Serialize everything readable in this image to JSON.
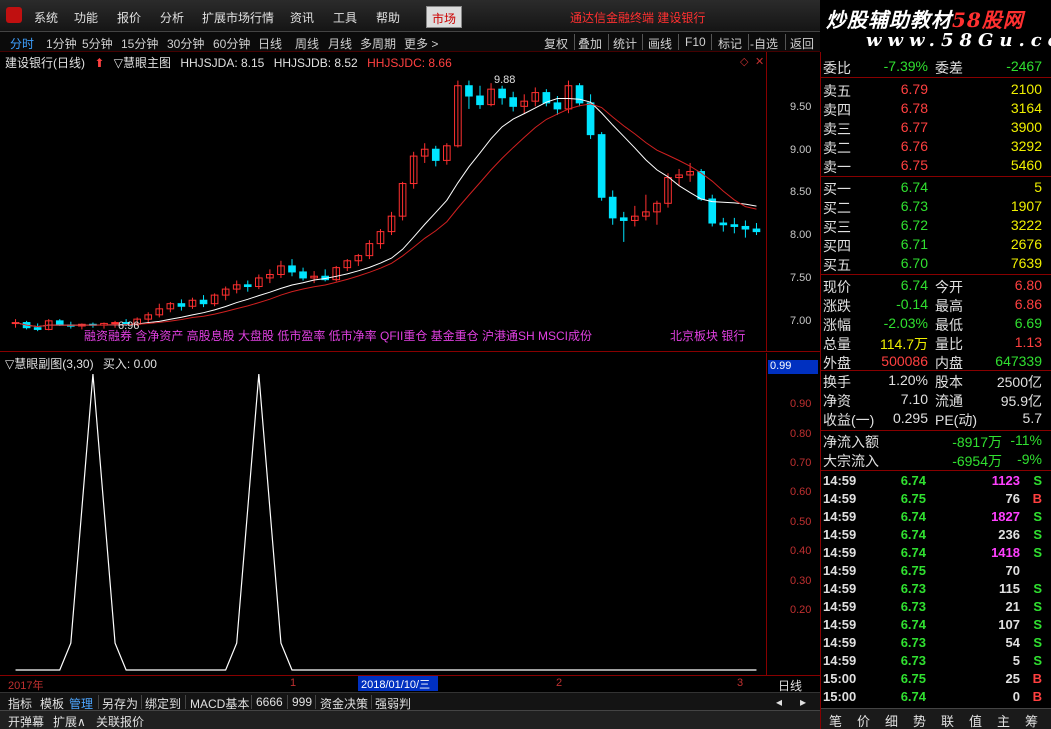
{
  "menu": {
    "items": [
      "系统",
      "功能",
      "报价",
      "分析",
      "扩展市场行情",
      "资讯",
      "工具",
      "帮助"
    ],
    "market_tab": "市场",
    "right_text": "通达信金融终端  建设银行"
  },
  "logo": {
    "title_main": "炒股辅助教材",
    "title_accent": "58股网",
    "url": "www.58Gu.com"
  },
  "periods": [
    "分时",
    "1分钟",
    "5分钟",
    "15分钟",
    "30分钟",
    "60分钟",
    "日线",
    "周线",
    "月线",
    "多周期",
    "更多 >"
  ],
  "active_period": "分时",
  "tools": [
    "复权",
    "叠加",
    "统计",
    "画线",
    "F10",
    "标记",
    "-自选",
    "返回"
  ],
  "chart_header": {
    "stock": "建设银行(日线)",
    "indicator": "▽慧眼主图",
    "hhjsjda": "HHJSJDA: 8.15",
    "hhjsjdb": "HHJSJDB: 8.52",
    "hhjsjdc": "HHJSJDC: 8.66"
  },
  "overlay": {
    "left": "融资融券 含净资产 高股息股 大盘股 低市盈率 低市净率 QFII重仓 基金重仓 沪港通SH MSCI成份",
    "right": "北京板块 银行"
  },
  "max_label": "9.88",
  "min_label": "6.96",
  "main_yticks": [
    "9.50",
    "9.00",
    "8.50",
    "8.00",
    "7.50",
    "7.00"
  ],
  "chart_data": {
    "type": "candlestick",
    "ylim": [
      6.95,
      9.98
    ],
    "candles": [
      [
        7.05,
        7.1,
        7.0,
        7.06
      ],
      [
        7.06,
        7.08,
        6.98,
        7.0
      ],
      [
        7.0,
        7.05,
        6.96,
        6.98
      ],
      [
        6.98,
        7.1,
        6.97,
        7.08
      ],
      [
        7.08,
        7.1,
        7.02,
        7.03
      ],
      [
        7.03,
        7.07,
        6.99,
        7.02
      ],
      [
        7.02,
        7.05,
        6.98,
        7.04
      ],
      [
        7.04,
        7.06,
        7.0,
        7.03
      ],
      [
        7.03,
        7.06,
        6.99,
        7.05
      ],
      [
        7.05,
        7.08,
        7.0,
        7.06
      ],
      [
        7.06,
        7.1,
        7.02,
        7.04
      ],
      [
        7.04,
        7.12,
        7.02,
        7.1
      ],
      [
        7.1,
        7.18,
        7.05,
        7.15
      ],
      [
        7.15,
        7.28,
        7.12,
        7.22
      ],
      [
        7.22,
        7.3,
        7.18,
        7.28
      ],
      [
        7.28,
        7.33,
        7.2,
        7.25
      ],
      [
        7.25,
        7.35,
        7.22,
        7.32
      ],
      [
        7.32,
        7.38,
        7.24,
        7.28
      ],
      [
        7.28,
        7.4,
        7.25,
        7.38
      ],
      [
        7.38,
        7.48,
        7.32,
        7.45
      ],
      [
        7.45,
        7.55,
        7.4,
        7.5
      ],
      [
        7.5,
        7.55,
        7.42,
        7.48
      ],
      [
        7.48,
        7.62,
        7.45,
        7.58
      ],
      [
        7.58,
        7.68,
        7.52,
        7.62
      ],
      [
        7.62,
        7.78,
        7.58,
        7.72
      ],
      [
        7.72,
        7.8,
        7.6,
        7.65
      ],
      [
        7.65,
        7.7,
        7.55,
        7.58
      ],
      [
        7.58,
        7.66,
        7.52,
        7.6
      ],
      [
        7.6,
        7.68,
        7.54,
        7.56
      ],
      [
        7.56,
        7.72,
        7.54,
        7.7
      ],
      [
        7.7,
        7.8,
        7.66,
        7.78
      ],
      [
        7.78,
        7.86,
        7.72,
        7.84
      ],
      [
        7.84,
        8.02,
        7.8,
        7.98
      ],
      [
        7.98,
        8.15,
        7.92,
        8.12
      ],
      [
        8.12,
        8.35,
        8.08,
        8.3
      ],
      [
        8.3,
        8.7,
        8.25,
        8.68
      ],
      [
        8.68,
        9.05,
        8.62,
        9.0
      ],
      [
        9.0,
        9.15,
        8.92,
        9.08
      ],
      [
        9.08,
        9.12,
        8.88,
        8.95
      ],
      [
        8.95,
        9.15,
        8.9,
        9.12
      ],
      [
        9.12,
        9.88,
        9.1,
        9.82
      ],
      [
        9.82,
        9.88,
        9.55,
        9.7
      ],
      [
        9.7,
        9.82,
        9.55,
        9.6
      ],
      [
        9.6,
        9.85,
        9.58,
        9.78
      ],
      [
        9.78,
        9.82,
        9.6,
        9.68
      ],
      [
        9.68,
        9.75,
        9.52,
        9.58
      ],
      [
        9.58,
        9.72,
        9.5,
        9.64
      ],
      [
        9.64,
        9.8,
        9.58,
        9.74
      ],
      [
        9.74,
        9.78,
        9.58,
        9.62
      ],
      [
        9.62,
        9.7,
        9.48,
        9.55
      ],
      [
        9.55,
        9.88,
        9.5,
        9.82
      ],
      [
        9.82,
        9.85,
        9.58,
        9.62
      ],
      [
        9.62,
        9.72,
        9.2,
        9.25
      ],
      [
        9.25,
        9.28,
        8.48,
        8.52
      ],
      [
        8.52,
        8.6,
        8.2,
        8.28
      ],
      [
        8.28,
        8.35,
        8.0,
        8.25
      ],
      [
        8.25,
        8.42,
        8.18,
        8.3
      ],
      [
        8.3,
        8.55,
        8.25,
        8.35
      ],
      [
        8.35,
        8.48,
        8.2,
        8.45
      ],
      [
        8.45,
        8.8,
        8.4,
        8.75
      ],
      [
        8.75,
        8.85,
        8.65,
        8.78
      ],
      [
        8.78,
        8.92,
        8.7,
        8.82
      ],
      [
        8.82,
        8.85,
        8.48,
        8.5
      ],
      [
        8.5,
        8.55,
        8.18,
        8.22
      ],
      [
        8.22,
        8.28,
        8.12,
        8.2
      ],
      [
        8.2,
        8.28,
        8.1,
        8.18
      ],
      [
        8.18,
        8.25,
        8.05,
        8.15
      ],
      [
        8.15,
        8.22,
        8.08,
        8.12
      ]
    ]
  },
  "sub_header": {
    "name": "▽慧眼副图(3,30)",
    "buy": "买入: 0.00"
  },
  "sub_value": "0.99",
  "sub_yticks": [
    "0.90",
    "0.80",
    "0.70",
    "0.60",
    "0.50",
    "0.40",
    "0.30",
    "0.20"
  ],
  "sub_chart_data": {
    "type": "line",
    "ylim": [
      0,
      1.0
    ],
    "peaks_at_candle": [
      7,
      22
    ],
    "peak_value": 0.99
  },
  "dates": {
    "year": "2017年",
    "cursor": "2018/01/10/三",
    "m1": "1",
    "m2": "2",
    "m3": "3",
    "period": "日线"
  },
  "indicator_tabs": [
    "指标",
    "模板",
    "管理",
    "另存为",
    "绑定到",
    "MACD基本",
    "6666",
    "999",
    "资金决策",
    "强弱判"
  ],
  "active_indicator_tab": "管理",
  "status_tabs": [
    "开弹幕",
    "扩展∧",
    "关联报价"
  ],
  "quote": {
    "weibi_label": "委比",
    "weibi": "-7.39%",
    "weicha_label": "委差",
    "weicha": "-2467",
    "asks": [
      {
        "label": "卖五",
        "price": "6.79",
        "vol": "2100"
      },
      {
        "label": "卖四",
        "price": "6.78",
        "vol": "3164"
      },
      {
        "label": "卖三",
        "price": "6.77",
        "vol": "3900"
      },
      {
        "label": "卖二",
        "price": "6.76",
        "vol": "3292"
      },
      {
        "label": "卖一",
        "price": "6.75",
        "vol": "5460"
      }
    ],
    "bids": [
      {
        "label": "买一",
        "price": "6.74",
        "vol": "5"
      },
      {
        "label": "买二",
        "price": "6.73",
        "vol": "1907"
      },
      {
        "label": "买三",
        "price": "6.72",
        "vol": "3222"
      },
      {
        "label": "买四",
        "price": "6.71",
        "vol": "2676"
      },
      {
        "label": "买五",
        "price": "6.70",
        "vol": "7639"
      }
    ],
    "stats": [
      {
        "l1": "现价",
        "v1": "6.74",
        "c1": "green",
        "l2": "今开",
        "v2": "6.80",
        "c2": "red"
      },
      {
        "l1": "涨跌",
        "v1": "-0.14",
        "c1": "green",
        "l2": "最高",
        "v2": "6.86",
        "c2": "red"
      },
      {
        "l1": "涨幅",
        "v1": "-2.03%",
        "c1": "green",
        "l2": "最低",
        "v2": "6.69",
        "c2": "green"
      },
      {
        "l1": "总量",
        "v1": "114.7万",
        "c1": "yellow",
        "l2": "量比",
        "v2": "1.13",
        "c2": "red"
      },
      {
        "l1": "外盘",
        "v1": "500086",
        "c1": "red",
        "l2": "内盘",
        "v2": "647339",
        "c2": "green"
      }
    ],
    "stats2": [
      {
        "l1": "换手",
        "v1": "1.20%",
        "l2": "股本",
        "v2": "2500亿"
      },
      {
        "l1": "净资",
        "v1": "7.10",
        "l2": "流通",
        "v2": "95.9亿"
      },
      {
        "l1": "收益(一)",
        "v1": "0.295",
        "l2": "PE(动)",
        "v2": "5.7"
      }
    ],
    "flows": [
      {
        "label": "净流入额",
        "amount": "-8917万",
        "pct": "-11%"
      },
      {
        "label": "大宗流入",
        "amount": "-6954万",
        "pct": "-9%"
      }
    ]
  },
  "ticks": [
    {
      "time": "14:59",
      "price": "6.74",
      "vol": "1123",
      "side": "S",
      "pc": "green",
      "vc": "magenta"
    },
    {
      "time": "14:59",
      "price": "6.75",
      "vol": "76",
      "side": "B",
      "pc": "green",
      "vc": "white"
    },
    {
      "time": "14:59",
      "price": "6.74",
      "vol": "1827",
      "side": "S",
      "pc": "green",
      "vc": "magenta"
    },
    {
      "time": "14:59",
      "price": "6.74",
      "vol": "236",
      "side": "S",
      "pc": "green",
      "vc": "white"
    },
    {
      "time": "14:59",
      "price": "6.74",
      "vol": "1418",
      "side": "S",
      "pc": "green",
      "vc": "magenta"
    },
    {
      "time": "14:59",
      "price": "6.75",
      "vol": "70",
      "side": "",
      "pc": "green",
      "vc": "white"
    },
    {
      "time": "14:59",
      "price": "6.73",
      "vol": "115",
      "side": "S",
      "pc": "green",
      "vc": "white"
    },
    {
      "time": "14:59",
      "price": "6.73",
      "vol": "21",
      "side": "S",
      "pc": "green",
      "vc": "white"
    },
    {
      "time": "14:59",
      "price": "6.74",
      "vol": "107",
      "side": "S",
      "pc": "green",
      "vc": "white"
    },
    {
      "time": "14:59",
      "price": "6.73",
      "vol": "54",
      "side": "S",
      "pc": "green",
      "vc": "white"
    },
    {
      "time": "14:59",
      "price": "6.73",
      "vol": "5",
      "side": "S",
      "pc": "green",
      "vc": "white"
    },
    {
      "time": "15:00",
      "price": "6.75",
      "vol": "25",
      "side": "B",
      "pc": "green",
      "vc": "white"
    },
    {
      "time": "15:00",
      "price": "6.74",
      "vol": "0",
      "side": "B",
      "pc": "green",
      "vc": "white"
    }
  ],
  "panel_tabs": [
    "笔",
    "价",
    "细",
    "势",
    "联",
    "值",
    "主",
    "筹"
  ],
  "colors": {
    "up": "#ff3030",
    "down": "#00e5ff",
    "ma1": "#ffffff",
    "ma2": "#d02020",
    "accent": "#3da0ff"
  }
}
